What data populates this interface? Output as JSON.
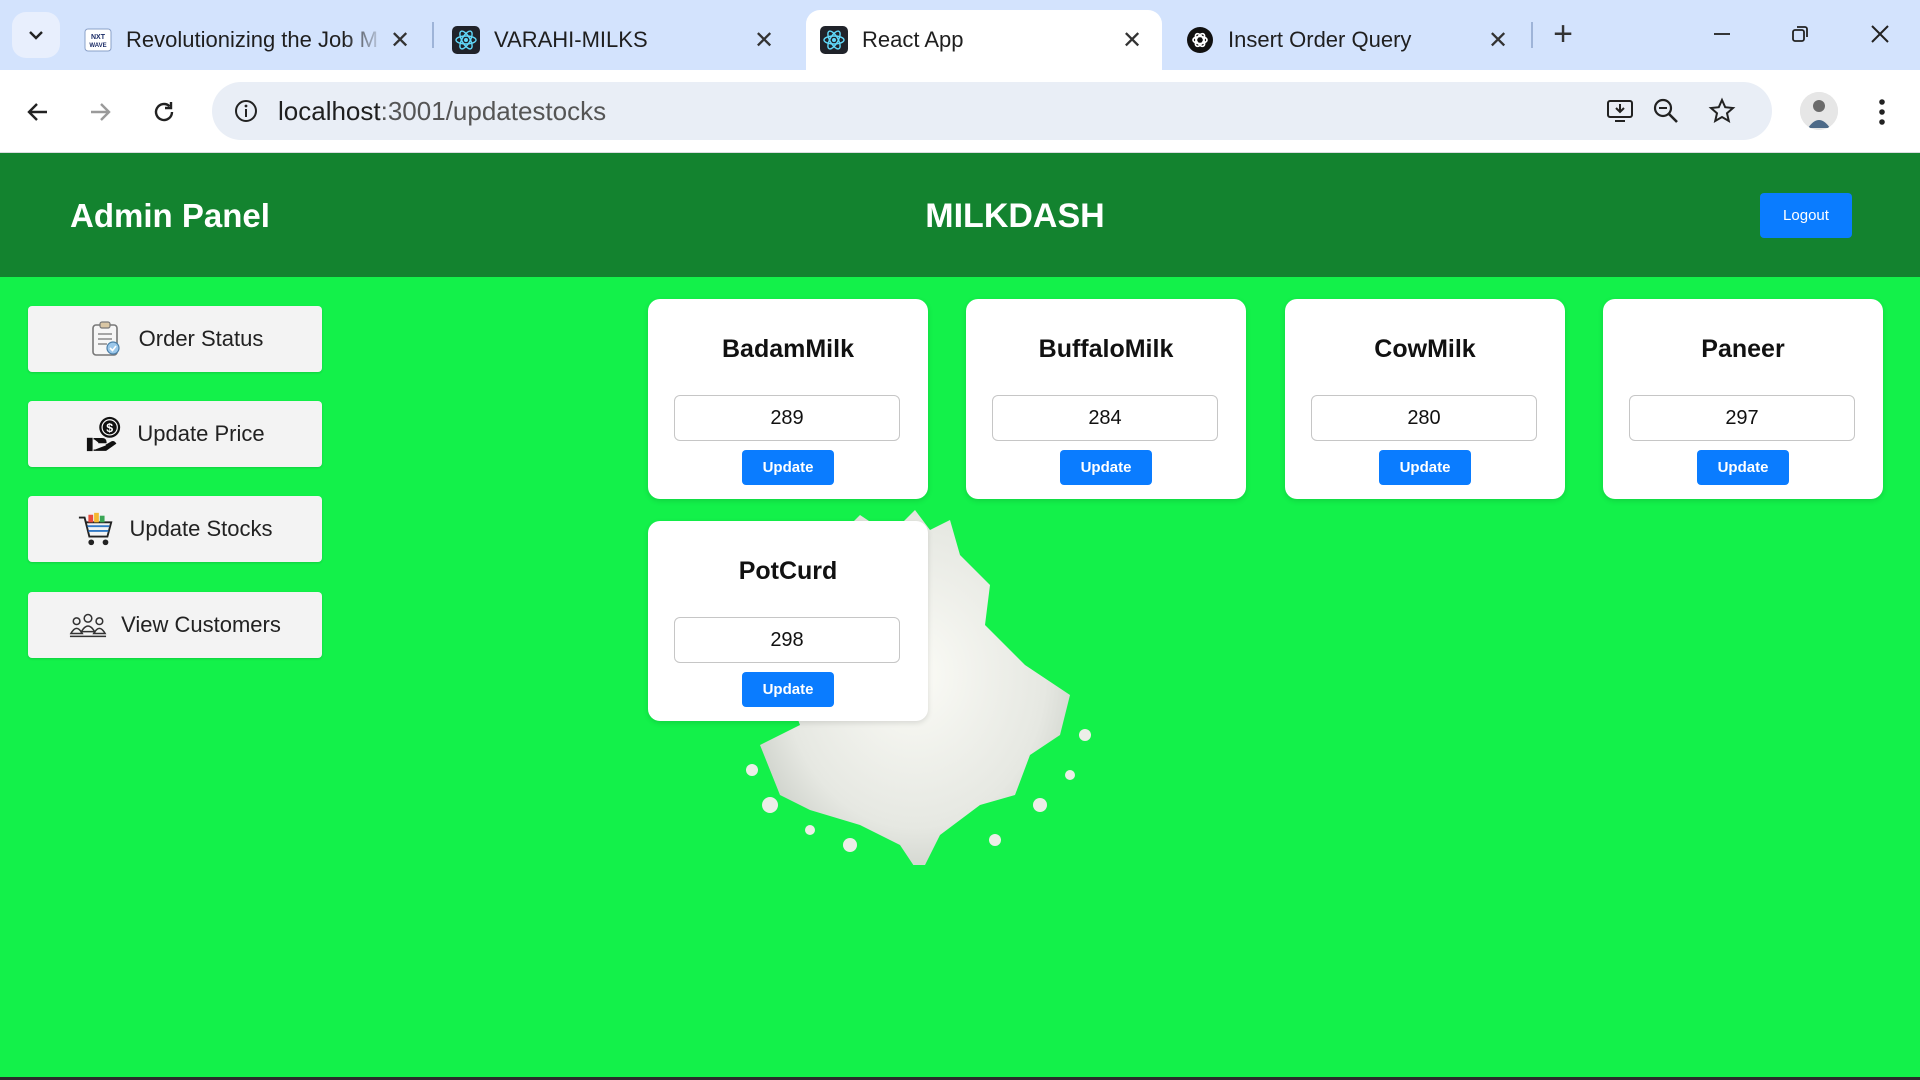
{
  "browser": {
    "tabs": [
      {
        "title": "Revolutionizing the Job M",
        "favicon": "nxtwave-icon",
        "active": false
      },
      {
        "title": "VARAHI-MILKS",
        "favicon": "react-icon",
        "active": false
      },
      {
        "title": "React App",
        "favicon": "react-icon",
        "active": true
      },
      {
        "title": "Insert Order Query",
        "favicon": "openai-icon",
        "active": false
      }
    ],
    "url_host": "localhost",
    "url_path": ":3001/updatestocks",
    "favicon_text": "NXT WAVE"
  },
  "header": {
    "admin_title": "Admin Panel",
    "brand": "MILKDASH",
    "logout_label": "Logout"
  },
  "sidebar": {
    "items": [
      {
        "label": "Order Status",
        "icon": "clipboard-icon"
      },
      {
        "label": "Update Price",
        "icon": "money-hand-icon"
      },
      {
        "label": "Update Stocks",
        "icon": "shopping-cart-icon"
      },
      {
        "label": "View Customers",
        "icon": "customers-icon"
      }
    ]
  },
  "products": [
    {
      "name": "BadamMilk",
      "stock": "289",
      "button": "Update"
    },
    {
      "name": "BuffaloMilk",
      "stock": "284",
      "button": "Update"
    },
    {
      "name": "CowMilk",
      "stock": "280",
      "button": "Update"
    },
    {
      "name": "Paneer",
      "stock": "297",
      "button": "Update"
    },
    {
      "name": "PotCurd",
      "stock": "298",
      "button": "Update"
    }
  ],
  "colors": {
    "page_background": "#13f14a",
    "header_background": "#13832f",
    "button_blue": "#0a7cff",
    "tabstrip": "#d3e3fd"
  }
}
